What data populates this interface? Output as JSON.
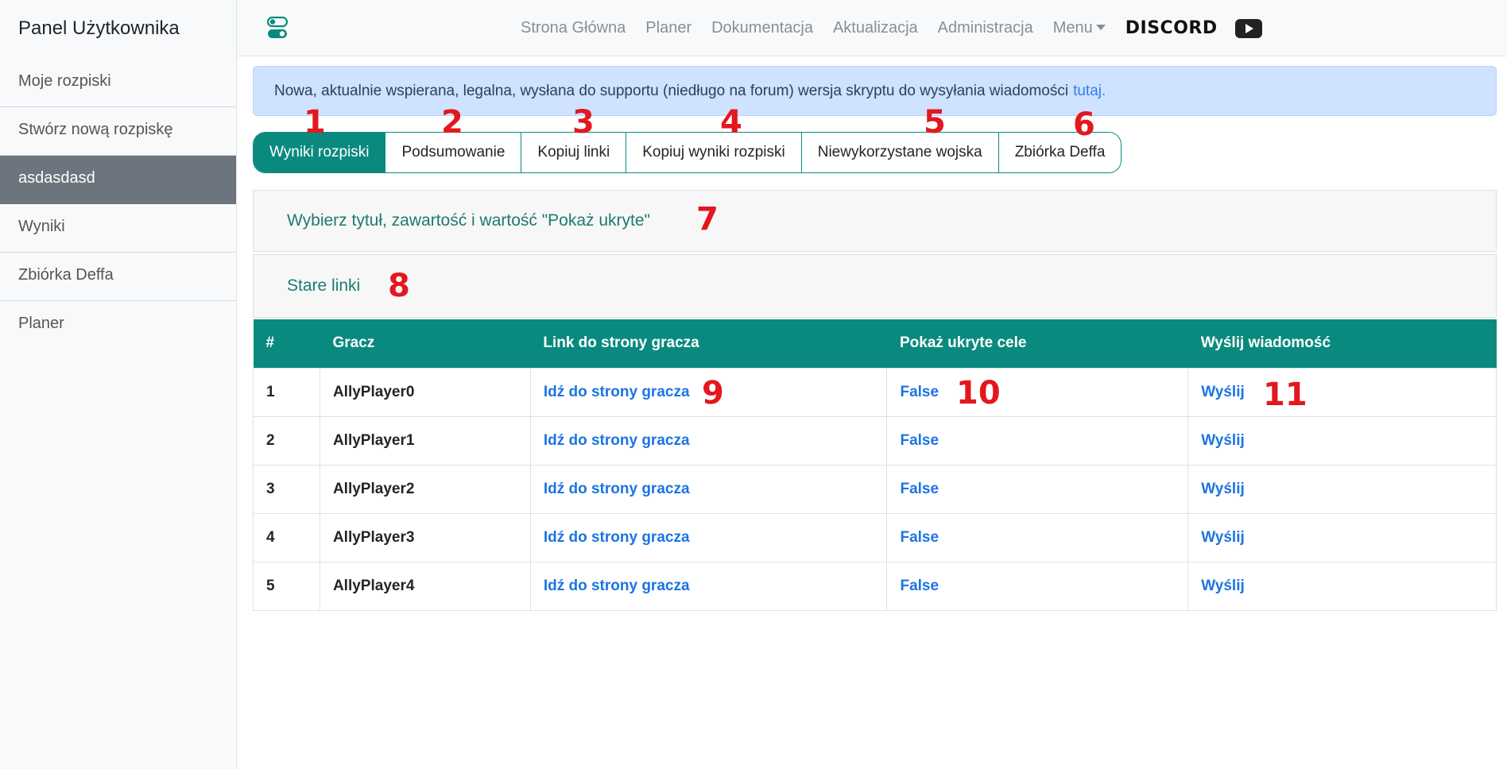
{
  "sidebar": {
    "title": "Panel Użytkownika",
    "items": [
      {
        "label": "Moje rozpiski"
      },
      {
        "label": "Stwórz nową rozpiskę"
      },
      {
        "label": "asdasdasd"
      },
      {
        "label": "Wyniki"
      },
      {
        "label": "Zbiórka Deffa"
      },
      {
        "label": "Planer"
      }
    ]
  },
  "navbar": {
    "brand_icon": "toggle-switches-icon",
    "links": [
      "Strona Główna",
      "Planer",
      "Dokumentacja",
      "Aktualizacja",
      "Administracja",
      "Menu"
    ],
    "discord_label": "DISCORD",
    "youtube_icon": "youtube-icon"
  },
  "alert": {
    "text": "Nowa, aktualnie wspierana, legalna, wysłana do supportu (niedługo na forum) wersja skryptu do wysyłania wiadomości",
    "link_text": "tutaj."
  },
  "tabs": [
    "Wyniki rozpiski",
    "Podsumowanie",
    "Kopiuj linki",
    "Kopiuj wyniki rozpiski",
    "Niewykorzystane wojska",
    "Zbiórka Deffa"
  ],
  "accordions": [
    "Wybierz tytuł, zawartość i wartość \"Pokaż ukryte\"",
    "Stare linki"
  ],
  "table": {
    "headers": [
      "#",
      "Gracz",
      "Link do strony gracza",
      "Pokaż ukryte cele",
      "Wyślij wiadomość"
    ],
    "rows": [
      {
        "num": "1",
        "player": "AllyPlayer0",
        "link": "Idź do strony gracza",
        "hidden": "False",
        "send": "Wyślij"
      },
      {
        "num": "2",
        "player": "AllyPlayer1",
        "link": "Idź do strony gracza",
        "hidden": "False",
        "send": "Wyślij"
      },
      {
        "num": "3",
        "player": "AllyPlayer2",
        "link": "Idź do strony gracza",
        "hidden": "False",
        "send": "Wyślij"
      },
      {
        "num": "4",
        "player": "AllyPlayer3",
        "link": "Idź do strony gracza",
        "hidden": "False",
        "send": "Wyślij"
      },
      {
        "num": "5",
        "player": "AllyPlayer4",
        "link": "Idź do strony gracza",
        "hidden": "False",
        "send": "Wyślij"
      }
    ]
  },
  "annotations": [
    "1",
    "2",
    "3",
    "4",
    "5",
    "6",
    "7",
    "8",
    "9",
    "10",
    "11"
  ],
  "colors": {
    "accent": "#0a8a7f",
    "annotation": "#e3171e",
    "link": "#1b74e4",
    "alert_bg": "#cfe2ff"
  }
}
